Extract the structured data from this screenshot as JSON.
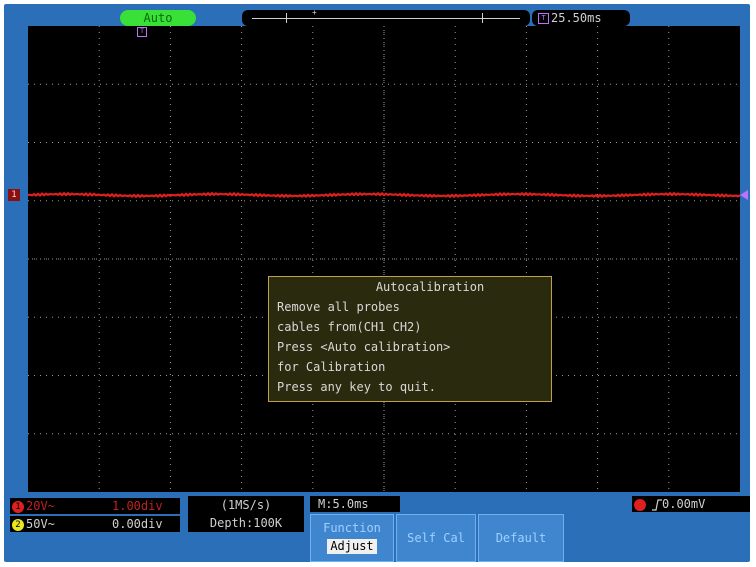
{
  "top": {
    "mode": "Auto",
    "delay_icon": "T",
    "delay": "25.50ms",
    "trigger_pos_marker": "T"
  },
  "screen": {
    "ch1_marker": "1"
  },
  "dialog": {
    "title": "Autocalibration",
    "lines": [
      "Remove all probes",
      "cables from(CH1 CH2)",
      "Press <Auto calibration>",
      "for Calibration",
      "Press any key to quit."
    ]
  },
  "status": {
    "ch1": {
      "dot": "1",
      "coupling": "20V~",
      "scale": "1.00div"
    },
    "ch2": {
      "dot": "2",
      "coupling": "50V~",
      "scale": "0.00div"
    },
    "sample_rate": "(1MS/s)",
    "depth": "Depth:100K",
    "main_time": "M:5.0ms",
    "trigger_level": "0.00mV",
    "trigger_edge": "rising-edge-icon"
  },
  "softkeys": {
    "function_title": "Function",
    "function_value": "Adjust",
    "self_cal": "Self Cal",
    "default": "Default"
  },
  "colors": {
    "frame": "#2a6fb8",
    "ch1": "#e02020",
    "mode_badge": "#38e038",
    "grid": "#9a9a9a"
  }
}
